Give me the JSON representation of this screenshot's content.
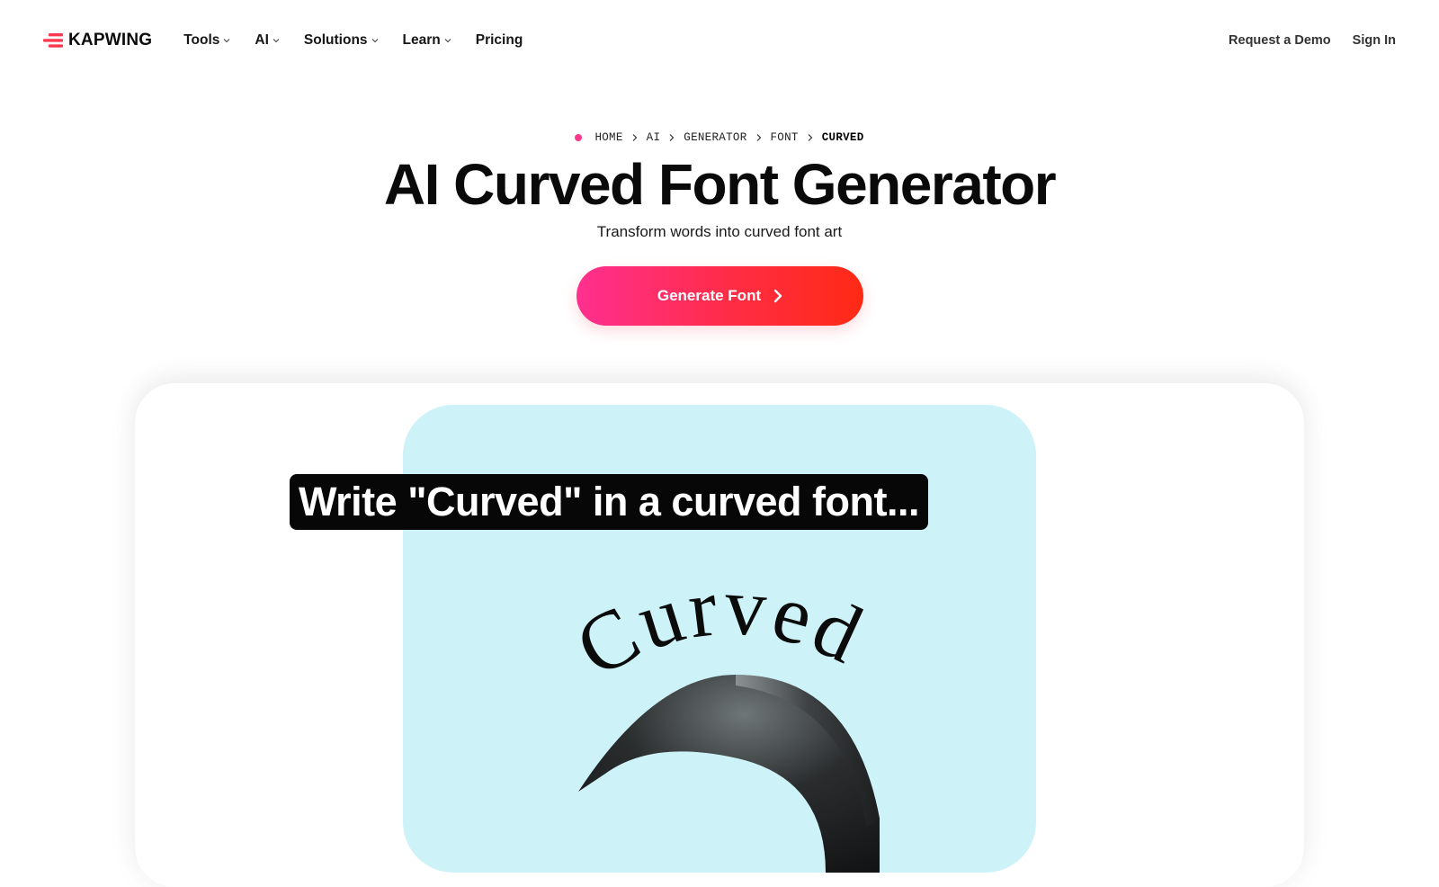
{
  "header": {
    "brand": "KAPWING",
    "nav": [
      {
        "label": "Tools",
        "has_dropdown": true
      },
      {
        "label": "AI",
        "has_dropdown": true
      },
      {
        "label": "Solutions",
        "has_dropdown": true
      },
      {
        "label": "Learn",
        "has_dropdown": true
      },
      {
        "label": "Pricing",
        "has_dropdown": false
      }
    ],
    "request_demo": "Request a Demo",
    "sign_in": "Sign In"
  },
  "breadcrumb": [
    "HOME",
    "AI",
    "GENERATOR",
    "FONT",
    "CURVED"
  ],
  "hero": {
    "title": "AI Curved Font Generator",
    "subtitle": "Transform words into curved font art",
    "cta_label": "Generate Font"
  },
  "demo": {
    "prompt": "Write \"Curved\" in a curved font...",
    "art_text": "Curved"
  },
  "colors": {
    "brand_red": "#ff3a4f",
    "brand_pink": "#ff3a8c",
    "cta_start": "#ff2f8f",
    "cta_end": "#ff2a14",
    "preview_bg": "#cdf3f9"
  },
  "icons": {
    "logo": "kapwing-logo-icon",
    "dropdown": "chevron-down-icon",
    "breadcrumb_separator": "chevron-right-icon",
    "cta_arrow": "chevron-right-icon"
  }
}
